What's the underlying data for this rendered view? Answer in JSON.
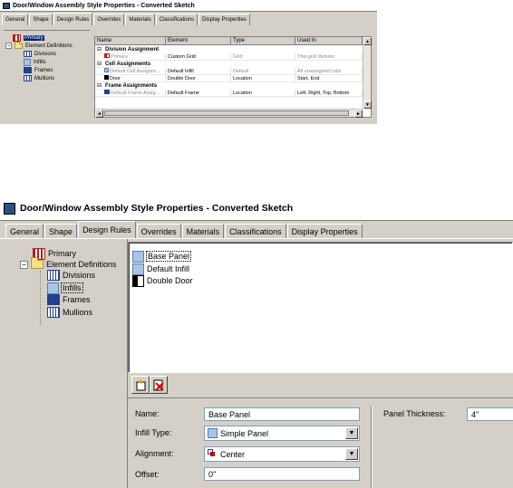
{
  "top": {
    "title": "Door/Window Assembly Style Properties - Converted Sketch",
    "tabs": [
      "General",
      "Shape",
      "Design Rules",
      "Overrides",
      "Materials",
      "Classifications",
      "Display Properties"
    ],
    "active_tab": "Design Rules",
    "tree": {
      "primary": "Primary",
      "element_definitions": "Element Definitions",
      "children": [
        "Divisions",
        "Infills",
        "Frames",
        "Mullions"
      ]
    },
    "table": {
      "columns": [
        "Name",
        "Element",
        "Type",
        "Used In"
      ],
      "groups": [
        {
          "label": "Division Assignment",
          "rows": [
            {
              "name": "Primary",
              "element": "Custom Grid",
              "type": "Grid",
              "used_in": "This grid division"
            }
          ]
        },
        {
          "label": "Cell Assignments",
          "rows": [
            {
              "name": "Default Cell Assignm...",
              "element": "Default Infill",
              "type": "Default",
              "used_in": "All unassigned cells"
            },
            {
              "name": "Door",
              "element": "Double Door",
              "type": "Location",
              "used_in": "Start, End"
            }
          ]
        },
        {
          "label": "Frame Assignments",
          "rows": [
            {
              "name": "Default Frame Assig...",
              "element": "Default Frame",
              "type": "Location",
              "used_in": "Left, Right, Top, Bottom"
            }
          ]
        }
      ]
    }
  },
  "bottom": {
    "title": "Door/Window Assembly Style Properties - Converted Sketch",
    "tabs": [
      "General",
      "Shape",
      "Design Rules",
      "Overrides",
      "Materials",
      "Classifications",
      "Display Properties"
    ],
    "active_tab": "Design Rules",
    "tree": {
      "primary": "Primary",
      "element_definitions": "Element Definitions",
      "children": [
        "Divisions",
        "Infills",
        "Frames",
        "Mullions"
      ],
      "selected": "Infills"
    },
    "list": [
      "Base Panel",
      "Default Infill",
      "Double Door"
    ],
    "form": {
      "name_label": "Name:",
      "name_value": "Base Panel",
      "infill_type_label": "Infill Type:",
      "infill_type_value": "Simple Panel",
      "alignment_label": "Alignment:",
      "alignment_value": "Center",
      "offset_label": "Offset:",
      "offset_value": "0\"",
      "panel_thickness_label": "Panel Thickness:",
      "panel_thickness_value": "4\""
    }
  },
  "colors": {
    "dialog_face": "#d4d0c8",
    "selection": "#0a246a",
    "title_icon": "#2f4f7f"
  }
}
